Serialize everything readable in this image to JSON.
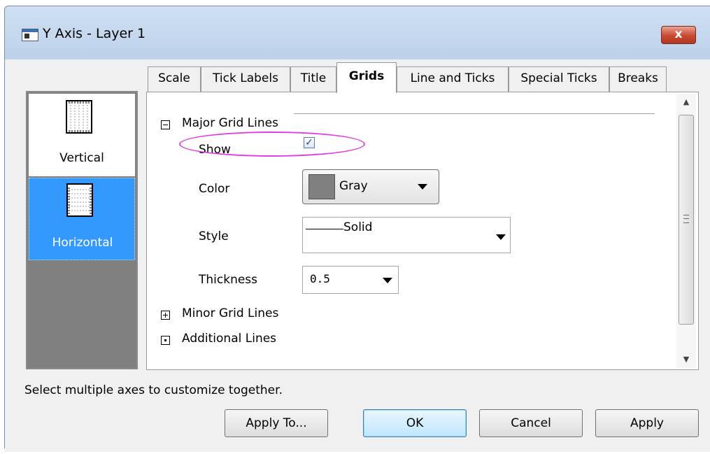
{
  "window": {
    "title": "Y Axis - Layer 1",
    "close_glyph": "x"
  },
  "axis_list": {
    "items": [
      {
        "label": "Vertical",
        "icon": "vertical-grid-icon",
        "selected": false
      },
      {
        "label": "Horizontal",
        "icon": "horizontal-grid-icon",
        "selected": true
      }
    ],
    "selected_color": "#3399ff"
  },
  "tabs": [
    "Scale",
    "Tick Labels",
    "Title",
    "Grids",
    "Line and Ticks",
    "Special Ticks",
    "Breaks"
  ],
  "active_tab": "Grids",
  "grids": {
    "major": {
      "section_label": "Major Grid Lines",
      "expanded": true,
      "show_label": "Show",
      "show_checked": true,
      "color_label": "Color",
      "color_value": "Gray",
      "color_swatch": "#808080",
      "style_label": "Style",
      "style_value": "Solid",
      "thickness_label": "Thickness",
      "thickness_value": "0.5"
    },
    "minor": {
      "section_label": "Minor Grid Lines",
      "expanded": false
    },
    "additional": {
      "section_label": "Additional Lines",
      "expanded": false
    }
  },
  "highlight_color": "#e040e0",
  "status_text": "Select multiple axes to customize together.",
  "buttons": {
    "apply_to": "Apply To...",
    "ok": "OK",
    "cancel": "Cancel",
    "apply": "Apply"
  }
}
